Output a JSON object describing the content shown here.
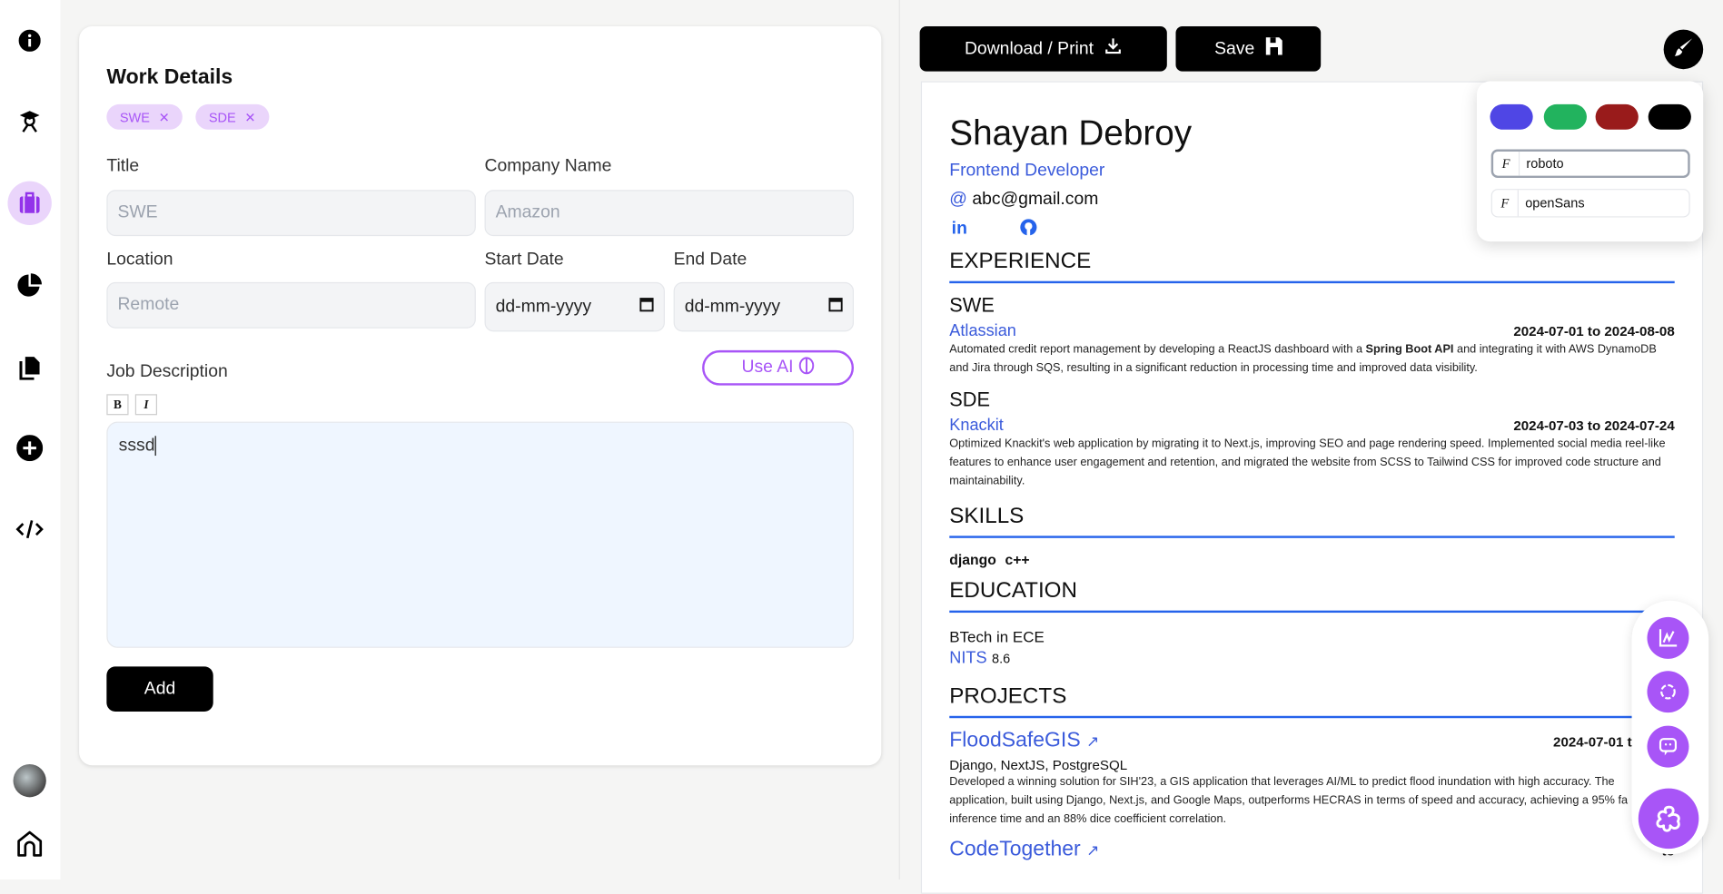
{
  "sidebar": {
    "items": [
      {
        "icon": "info-icon"
      },
      {
        "icon": "graduation-icon"
      },
      {
        "icon": "briefcase-icon",
        "active": true
      },
      {
        "icon": "pie-chart-icon"
      },
      {
        "icon": "documents-icon"
      },
      {
        "icon": "plus-circle-icon"
      },
      {
        "icon": "code-icon"
      }
    ],
    "bottom": [
      {
        "icon": "avatar"
      },
      {
        "icon": "home-icon"
      }
    ]
  },
  "form": {
    "title": "Work Details",
    "chips": [
      "SWE",
      "SDE"
    ],
    "labels": {
      "title": "Title",
      "company": "Company Name",
      "location": "Location",
      "start": "Start Date",
      "end": "End Date",
      "description": "Job Description"
    },
    "placeholders": {
      "title": "SWE",
      "company": "Amazon",
      "location": "Remote",
      "start": "dd-mm-yyyy",
      "end": "dd-mm-yyyy"
    },
    "use_ai": "Use AI",
    "bold": "B",
    "italic": "I",
    "description_value": "sssd",
    "add": "Add"
  },
  "toolbar": {
    "download": "Download / Print",
    "save": "Save"
  },
  "theme": {
    "colors": [
      "#4f46e5",
      "#22b35e",
      "#991b1b",
      "#000000"
    ],
    "fonts": [
      "roboto",
      "openSans"
    ],
    "selected_font": "roboto"
  },
  "resume": {
    "name": "Shayan Debroy",
    "role": "Frontend Developer",
    "email_prefix": "@",
    "email": "abc@gmail.com",
    "sections": {
      "experience": "EXPERIENCE",
      "skills": "SKILLS",
      "education": "EDUCATION",
      "projects": "PROJECTS"
    },
    "experience": [
      {
        "title": "SWE",
        "company": "Atlassian",
        "dates": "2024-07-01 to 2024-08-08",
        "desc_a": "Automated credit report management by developing a ReactJS dashboard with a ",
        "desc_bold": "Spring Boot API",
        "desc_b": " and integrating it with AWS DynamoDB and Jira through SQS, resulting in a significant reduction in processing time and improved data visibility."
      },
      {
        "title": "SDE",
        "company": "Knackit",
        "dates": "2024-07-03 to 2024-07-24",
        "desc": "Optimized Knackit's web application by migrating it to Next.js, improving SEO and page rendering speed. Implemented social media reel-like features to enhance user engagement and retention, and migrated the website from SCSS to Tailwind CSS for improved code structure and maintainability."
      }
    ],
    "skills": [
      "django",
      "c++"
    ],
    "education": {
      "degree": "BTech in ECE",
      "school": "NITS",
      "score": "8.6"
    },
    "projects": [
      {
        "name": "FloodSafeGIS",
        "dates": "2024-07-01 to 2024",
        "stack": "Django, NextJS, PostgreSQL",
        "desc": "Developed a winning solution for SIH'23, a GIS application that leverages AI/ML to predict flood inundation with high accuracy. The application, built using Django, Next.js, and Google Maps, outperforms HECRAS in terms of speed and accuracy, achieving a 95% fa inference time and an 88% dice coefficient correlation."
      },
      {
        "name": "CodeTogether",
        "dates": "to"
      }
    ]
  },
  "fabs": [
    "analytics-icon",
    "openai-icon",
    "chat-bot-icon",
    "assistant-icon"
  ]
}
